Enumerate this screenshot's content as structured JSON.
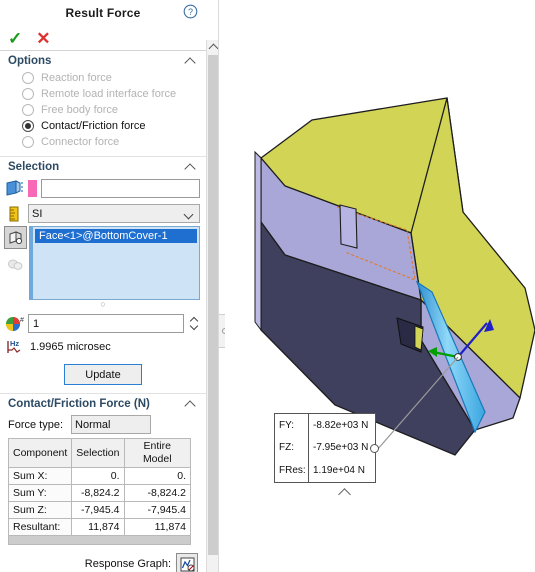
{
  "panel": {
    "title": "Result Force",
    "help_icon": "help-icon",
    "accept_label": "✓",
    "cancel_label": "✕"
  },
  "options": {
    "header": "Options",
    "items": [
      {
        "label": "Reaction force",
        "selected": false,
        "enabled": false
      },
      {
        "label": "Remote load interface force",
        "selected": false,
        "enabled": false
      },
      {
        "label": "Free body force",
        "selected": false,
        "enabled": false
      },
      {
        "label": "Contact/Friction force",
        "selected": true,
        "enabled": true
      },
      {
        "label": "Connector force",
        "selected": false,
        "enabled": false
      }
    ]
  },
  "selection": {
    "header": "Selection",
    "face_input_value": "",
    "units_icon": "ruler-icon",
    "units_value": "SI",
    "face_icon": "face-select-icon",
    "entity_list": [
      "Face<1>@BottomCover-1"
    ],
    "plot_step_icon": "plot-step-icon",
    "plot_step_value": "1",
    "time_icon": "frequency-icon",
    "time_value": "1.9965 microsec",
    "update_label": "Update"
  },
  "results": {
    "header": "Contact/Friction Force (N)",
    "force_type_label": "Force type:",
    "force_type_value": "Normal",
    "columns": [
      "Component",
      "Selection",
      "Entire Model"
    ],
    "rows": [
      {
        "component": "Sum X:",
        "selection": "0.",
        "entire_model": "0."
      },
      {
        "component": "Sum Y:",
        "selection": "-8,824.2",
        "entire_model": "-8,824.2"
      },
      {
        "component": "Sum Z:",
        "selection": "-7,945.4",
        "entire_model": "-7,945.4"
      },
      {
        "component": "Resultant:",
        "selection": "11,874",
        "entire_model": "11,874"
      }
    ],
    "response_graph_label": "Response Graph:",
    "response_graph_icon": "response-graph-icon"
  },
  "graphics": {
    "callout": {
      "rows": [
        {
          "key": "FY:",
          "value": "-8.82e+03 N"
        },
        {
          "key": "FZ:",
          "value": "-7.95e+03 N"
        },
        {
          "key": "FRes:",
          "value": "1.19e+04 N"
        }
      ]
    },
    "model_name": "bottom-cover-assembly",
    "colors": {
      "top_face": "#d2d456",
      "mid_face": "#a9a7d8",
      "front_face": "#3f3f5e",
      "selected_face": "#4db8f0",
      "cylinder": "#4a4a4a",
      "force_arrow": "#2020c8",
      "axis_green": "#00a000"
    }
  }
}
